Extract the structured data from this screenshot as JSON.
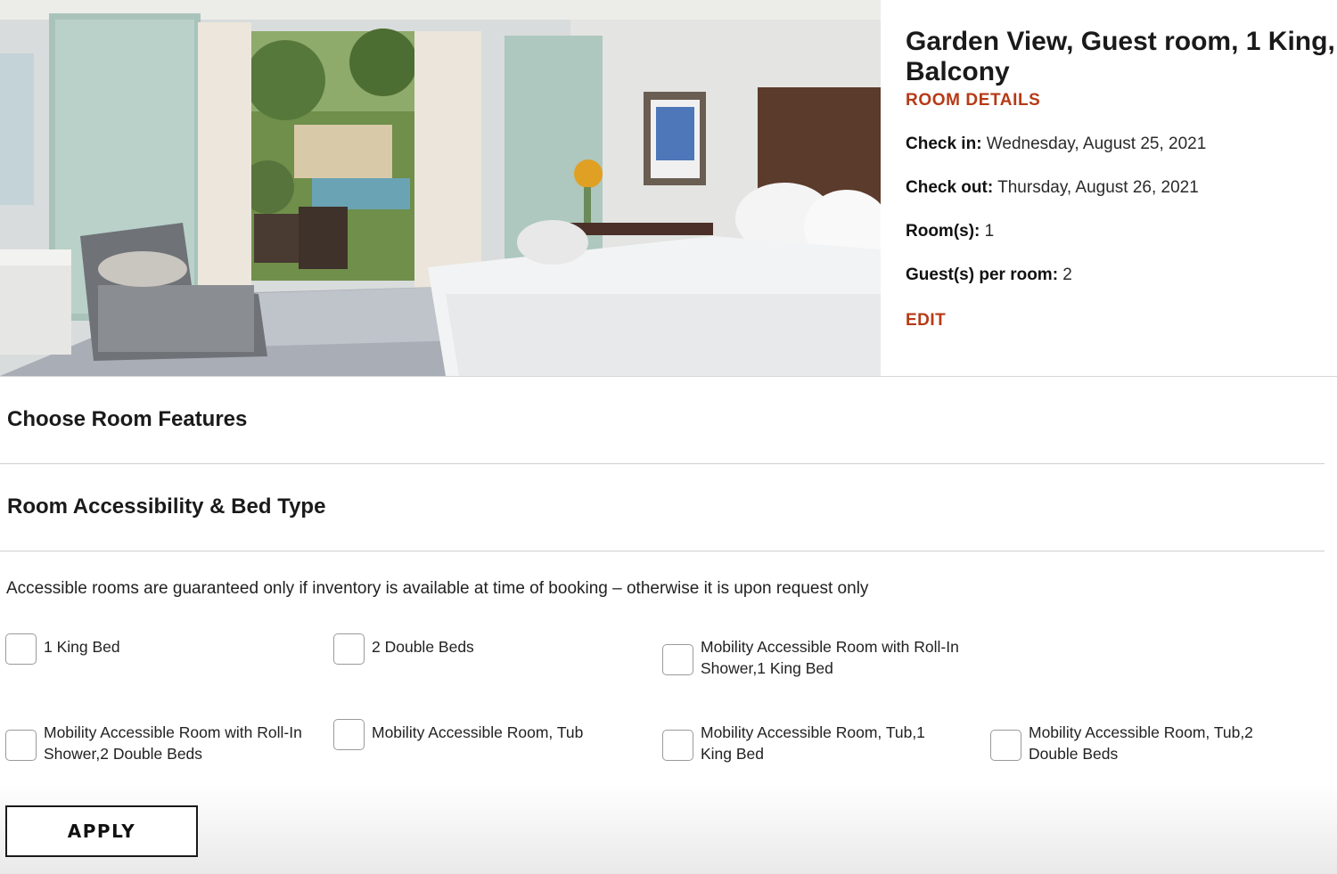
{
  "room": {
    "title_line1": "Garden View, Guest room, 1 King,",
    "title_line2": "Balcony",
    "details_link": "ROOM DETAILS",
    "check_in_label": "Check in:",
    "check_in_value": " Wednesday, August 25, 2021",
    "check_out_label": "Check out:",
    "check_out_value": " Thursday, August 26, 2021",
    "rooms_label": "Room(s):",
    "rooms_value": " 1",
    "guests_label": "Guest(s) per room:",
    "guests_value": " 2",
    "edit_label": "EDIT"
  },
  "sections": {
    "features_title": "Choose Room Features",
    "accessibility_title": "Room Accessibility & Bed Type"
  },
  "accessibility_note": "Accessible rooms are guaranteed only if inventory is available at time of booking – otherwise it is upon request only",
  "options": [
    {
      "label": "1 King Bed",
      "checked": false
    },
    {
      "label": "2 Double Beds",
      "checked": false
    },
    {
      "label": "Mobility Accessible Room with Roll-In Shower,1 King Bed",
      "checked": false
    },
    {
      "label": "Mobility Accessible Room with Roll-In Shower,2 Double Beds",
      "checked": false
    },
    {
      "label": "Mobility Accessible Room, Tub",
      "checked": false
    },
    {
      "label": "Mobility Accessible Room, Tub,1 King Bed",
      "checked": false
    },
    {
      "label": "Mobility Accessible Room, Tub,2 Double Beds",
      "checked": false
    }
  ],
  "apply_label": "APPLY",
  "colors": {
    "accent": "#b63a16",
    "text": "#1a1a1a",
    "divider": "#cfcfcf"
  }
}
